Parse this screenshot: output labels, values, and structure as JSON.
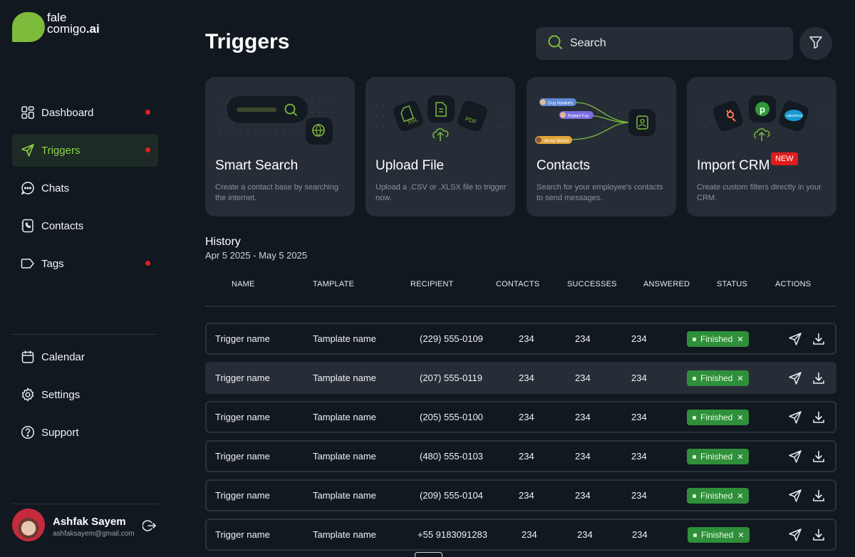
{
  "brand": {
    "line1": "fale",
    "line2": "comigo",
    "line2_suffix": ".ai",
    "color": "#7dbb3c"
  },
  "nav": [
    {
      "label": "Dashboard",
      "icon": "grid-icon",
      "dot": true
    },
    {
      "label": "Triggers",
      "icon": "send-icon",
      "dot": true,
      "active": true
    },
    {
      "label": "Chats",
      "icon": "chat-icon",
      "dot": false
    },
    {
      "label": "Contacts",
      "icon": "phone-book-icon",
      "dot": false
    },
    {
      "label": "Tags",
      "icon": "tag-icon",
      "dot": true
    }
  ],
  "nav_secondary": [
    {
      "label": "Calendar",
      "icon": "calendar-icon"
    },
    {
      "label": "Settings",
      "icon": "gear-icon"
    },
    {
      "label": "Support",
      "icon": "help-icon"
    }
  ],
  "user": {
    "name": "Ashfak Sayem",
    "email": "ashfaksayem@gmail.com"
  },
  "page": {
    "title": "Triggers"
  },
  "search": {
    "placeholder": "Search"
  },
  "cards": [
    {
      "title": "Smart Search",
      "desc": "Create a contact base by searching the internet."
    },
    {
      "title": "Upload File",
      "desc": "Upload a .CSV or .XLSX file to trigger now.",
      "file_labels": [
        "XSL",
        "PDF"
      ]
    },
    {
      "title": "Contacts",
      "desc": "Search for your employee's contacts to send messages.",
      "chips": [
        "Guy Hawkins",
        "Robert Fox",
        "Jenny Wilson"
      ]
    },
    {
      "title": "Import CRM",
      "desc": "Create custom filters directly in your CRM.",
      "badge": "NEW",
      "crm_logos": [
        "p",
        "salesforce"
      ]
    }
  ],
  "history": {
    "title": "History",
    "range": "Apr 5 2025 - May 5 2025",
    "columns": [
      "NAME",
      "TAMPLATE",
      "RECIPIENT",
      "CONTACTS",
      "SUCCESSES",
      "ANSWERED",
      "STATUS",
      "ACTIONS"
    ],
    "rows": [
      {
        "name": "Trigger name",
        "template": "Tamplate name",
        "recipient": "(229) 555-0109",
        "contacts": "234",
        "successes": "234",
        "answered": "234",
        "status": "Finished"
      },
      {
        "name": "Trigger name",
        "template": "Tamplate name",
        "recipient": "(207) 555-0119",
        "contacts": "234",
        "successes": "234",
        "answered": "234",
        "status": "Finished"
      },
      {
        "name": "Trigger name",
        "template": "Tamplate name",
        "recipient": "(205) 555-0100",
        "contacts": "234",
        "successes": "234",
        "answered": "234",
        "status": "Finished"
      },
      {
        "name": "Trigger name",
        "template": "Tamplate name",
        "recipient": "(480) 555-0103",
        "contacts": "234",
        "successes": "234",
        "answered": "234",
        "status": "Finished"
      },
      {
        "name": "Trigger name",
        "template": "Tamplate name",
        "recipient": "(209) 555-0104",
        "contacts": "234",
        "successes": "234",
        "answered": "234",
        "status": "Finished"
      },
      {
        "name": "Trigger name",
        "template": "Tamplate name",
        "recipient": "+55 9183091283",
        "contacts": "234",
        "successes": "234",
        "answered": "234",
        "status": "Finished"
      }
    ]
  },
  "colors": {
    "accent": "#8cd247",
    "status_green": "#2f8f3a",
    "alert_red": "#e02020",
    "panel": "#262d36",
    "bg": "#111820"
  }
}
